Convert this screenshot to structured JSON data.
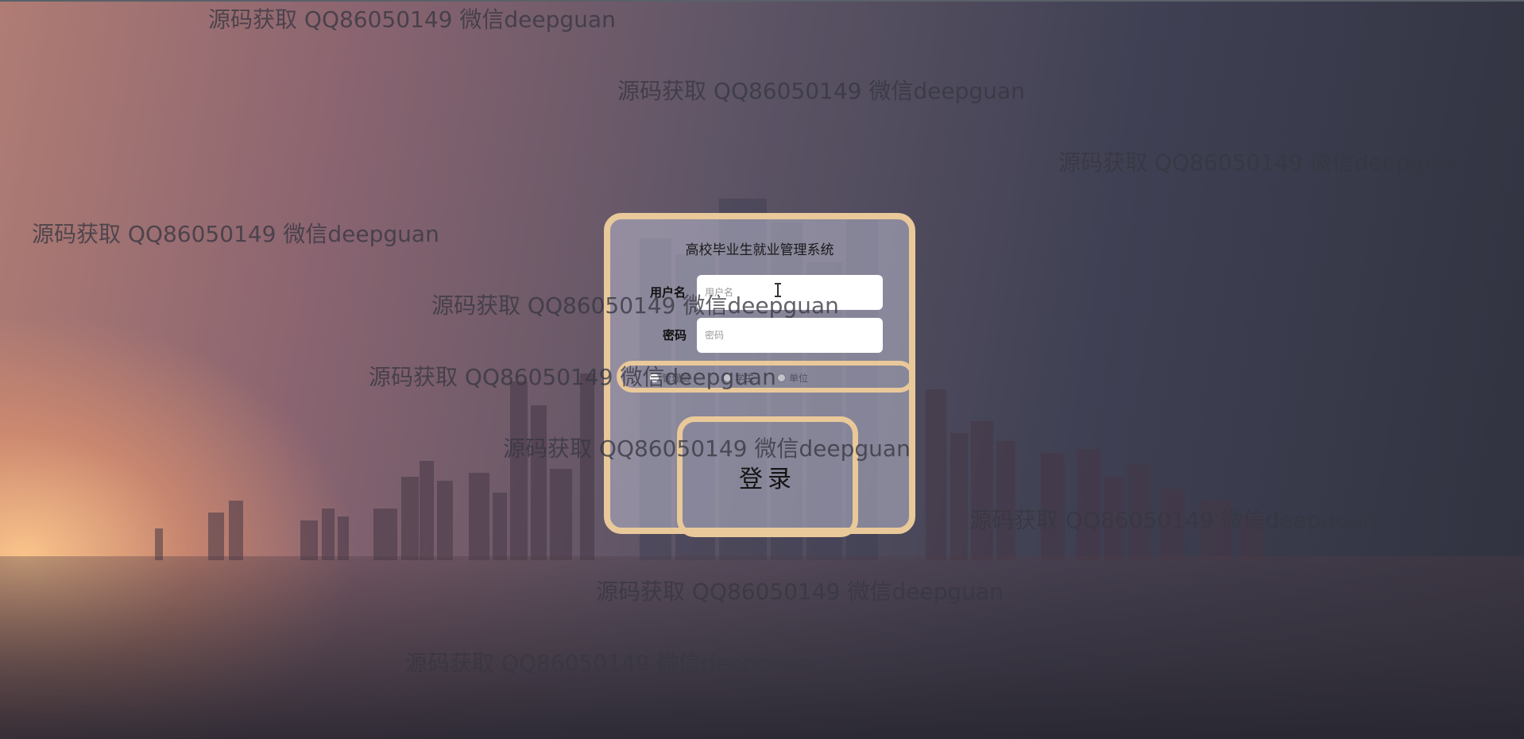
{
  "app": {
    "title": "高校毕业生就业管理系统"
  },
  "login": {
    "username_label": "用户名",
    "username_placeholder": "用户名",
    "username_value": "",
    "password_label": "密码",
    "password_placeholder": "密码",
    "password_value": "",
    "roles": [
      {
        "label": "管理员",
        "selected": true
      },
      {
        "label": "学生",
        "selected": false
      },
      {
        "label": "单位",
        "selected": false
      }
    ],
    "submit_label": "登录"
  },
  "watermarks": [
    "源码获取 QQ86050149 微信deepguan",
    "源码获取 QQ86050149 微信deepguan",
    "源码获取 QQ86050149 微信deepguan",
    "源码获取 QQ86050149 微信deepguan",
    "源码获取 QQ86050149 微信deepguan",
    "源码获取 QQ86050149 微信deepguan",
    "源码获取 QQ86050149 微信deepguan",
    "源码获取 QQ86050149 微信deepguan",
    "源码获取 QQ86050149 微信deepguan",
    "源码获取 QQ86050149 微信deepguan"
  ],
  "colors": {
    "card_border": "#e9c99a",
    "card_background": "#b9b9cd"
  }
}
